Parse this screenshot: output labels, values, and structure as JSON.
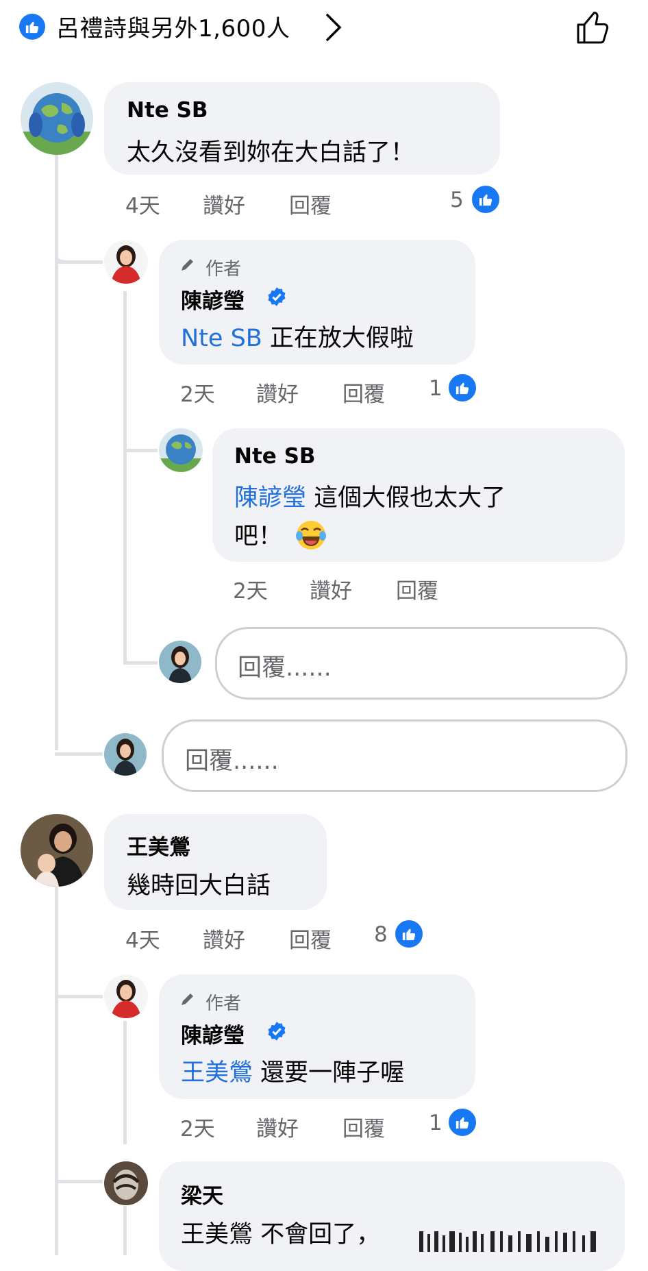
{
  "header": {
    "reactions_text": "呂禮詩與另外1,600人"
  },
  "comments": [
    {
      "name": "Nte SB",
      "text": "太久沒看到妳在大白話了！",
      "time": "4天",
      "like": "讚好",
      "reply": "回覆",
      "count": "5"
    },
    {
      "author_tag": "作者",
      "name": "陳諺瑩",
      "mention": "Nte SB",
      "text": " 正在放大假啦",
      "time": "2天",
      "like": "讚好",
      "reply": "回覆",
      "count": "1"
    },
    {
      "name": "Nte SB",
      "mention": "陳諺瑩",
      "text_line1": " 這個大假也太大了",
      "text_line2": "吧！",
      "time": "2天",
      "like": "讚好",
      "reply": "回覆"
    },
    {
      "name": "王美鶯",
      "text": "幾時回大白話",
      "time": "4天",
      "like": "讚好",
      "reply": "回覆",
      "count": "8"
    },
    {
      "author_tag": "作者",
      "name": "陳諺瑩",
      "mention": "王美鶯",
      "text": " 還要一陣子喔",
      "time": "2天",
      "like": "讚好",
      "reply": "回覆",
      "count": "1"
    },
    {
      "name": "梁天",
      "text": "王美鶯 不會回了，"
    }
  ],
  "reply_boxes": [
    {
      "placeholder": "回覆......"
    },
    {
      "placeholder": "回覆......"
    }
  ],
  "icons": {
    "like": "thumbs-up-icon",
    "verified": "verified-badge-icon",
    "author": "pencil-icon",
    "emoji": "tears-of-joy-emoji"
  },
  "colors": {
    "accent": "#1877f2",
    "mention": "#216fdb",
    "bubble": "#f0f2f5",
    "meta": "#65676b"
  }
}
